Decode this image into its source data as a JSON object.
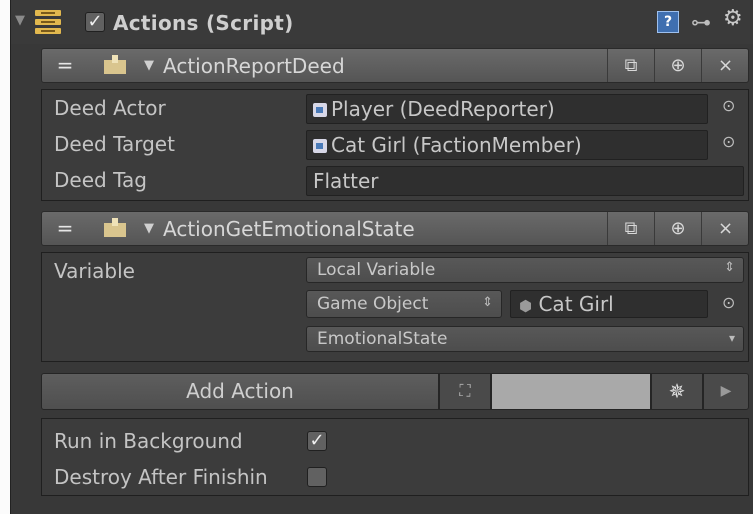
{
  "component": {
    "title": "Actions (Script)",
    "enabled": true,
    "help_icon": "help-book-icon",
    "preset_icon": "preset-sliders-icon",
    "settings_icon": "gear-icon"
  },
  "actions": [
    {
      "name": "ActionReportDeed",
      "fields": [
        {
          "label": "Deed Actor",
          "value": "Player (DeedReporter)",
          "type": "object"
        },
        {
          "label": "Deed Target",
          "value": "Cat Girl (FactionMember)",
          "type": "object"
        },
        {
          "label": "Deed Tag",
          "value": "Flatter",
          "type": "text"
        }
      ]
    },
    {
      "name": "ActionGetEmotionalState",
      "variable_label": "Variable",
      "variable_type": "Local Variable",
      "scope_type": "Game Object",
      "scope_object": "Cat Girl",
      "component_select": "EmotionalState"
    }
  ],
  "header_buttons": {
    "drag": "=",
    "copy": "copy-icon",
    "add": "add-icon",
    "close": "×"
  },
  "add_action": {
    "label": "Add Action",
    "search_value": ""
  },
  "options": [
    {
      "label": "Run in Background",
      "checked": true
    },
    {
      "label": "Destroy After Finishin",
      "checked": false
    }
  ]
}
